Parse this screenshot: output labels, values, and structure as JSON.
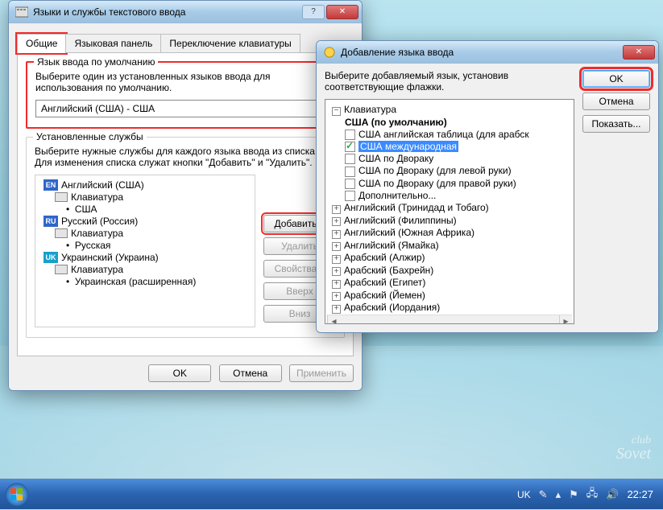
{
  "dlg1": {
    "title": "Языки и службы текстового ввода",
    "tabs": [
      "Общие",
      "Языковая панель",
      "Переключение клавиатуры"
    ],
    "defaultGroup": {
      "legend": "Язык ввода по умолчанию",
      "desc": "Выберите один из установленных языков ввода для использования по умолчанию.",
      "combo": "Английский (США) - США"
    },
    "servicesGroup": {
      "legend": "Установленные службы",
      "desc": "Выберите нужные службы для каждого языка ввода из списка. Для изменения списка служат кнопки \"Добавить\" и \"Удалить\".",
      "tree": [
        {
          "badge": "EN",
          "badgeColor": "#2f66c9",
          "lang": "Английский (США)",
          "kb": "Клавиатура",
          "layouts": [
            "США"
          ]
        },
        {
          "badge": "RU",
          "badgeColor": "#2f66c9",
          "lang": "Русский (Россия)",
          "kb": "Клавиатура",
          "layouts": [
            "Русская"
          ]
        },
        {
          "badge": "UK",
          "badgeColor": "#17a0cc",
          "lang": "Украинский (Украина)",
          "kb": "Клавиатура",
          "layouts": [
            "Украинская (расширенная)"
          ]
        }
      ],
      "buttons": {
        "add": "Добавить...",
        "remove": "Удалить",
        "props": "Свойства...",
        "up": "Вверх",
        "down": "Вниз"
      }
    },
    "dlgButtons": {
      "ok": "OK",
      "cancel": "Отмена",
      "apply": "Применить"
    }
  },
  "dlg2": {
    "title": "Добавление языка ввода",
    "desc": "Выберите добавляемый язык, установив соответствующие флажки.",
    "root": "Клавиатура",
    "defaultNode": "США (по умолчанию)",
    "checks": [
      {
        "label": "США английская таблица (для арабск",
        "checked": false
      },
      {
        "label": "США международная",
        "checked": true,
        "selected": true
      },
      {
        "label": "США по Двораку",
        "checked": false
      },
      {
        "label": "США по Двораку (для левой руки)",
        "checked": false
      },
      {
        "label": "США по Двораку (для правой руки)",
        "checked": false
      },
      {
        "label": "Дополнительно...",
        "checked": false
      }
    ],
    "langs": [
      "Английский (Тринидад и Тобаго)",
      "Английский (Филиппины)",
      "Английский (Южная Африка)",
      "Английский (Ямайка)",
      "Арабский (Алжир)",
      "Арабский (Бахрейн)",
      "Арабский (Египет)",
      "Арабский (Йемен)",
      "Арабский (Иордания)"
    ],
    "buttons": {
      "ok": "OK",
      "cancel": "Отмена",
      "show": "Показать..."
    }
  },
  "taskbar": {
    "lang": "UK",
    "time": "22:27"
  },
  "watermark": {
    "l1": "club",
    "l2": "Sovet"
  }
}
